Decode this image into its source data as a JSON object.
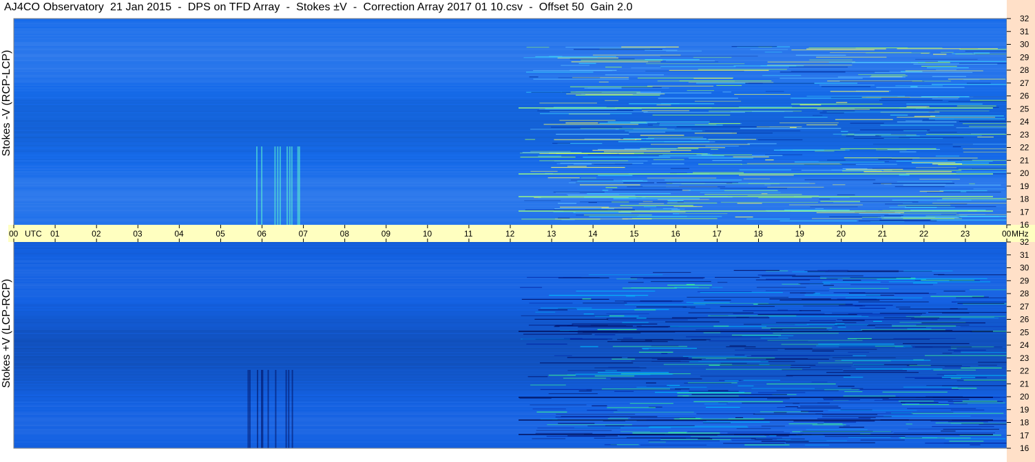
{
  "title": "AJ4CO Observatory  21 Jan 2015  -  DPS on TFD Array  -  Stokes ±V  -  Correction Array 2017 01 10.csv  -  Offset 50  Gain 2.0",
  "panels": {
    "top_label": "Stokes -V (RCP-LCP)",
    "bottom_label": "Stokes +V (LCP-RCP)"
  },
  "colors": {
    "background": "#1060e0",
    "axis_band": "#ffffc0",
    "freq_band": "#ffe0c8"
  },
  "chart_data": {
    "type": "heatmap",
    "title": "AJ4CO Observatory  21 Jan 2015  -  DPS on TFD Array  -  Stokes ±V  -  Correction Array 2017 01 10.csv  -  Offset 50  Gain 2.0",
    "x_tick_labels": [
      "00",
      "01",
      "02",
      "03",
      "04",
      "05",
      "06",
      "07",
      "08",
      "09",
      "10",
      "11",
      "12",
      "13",
      "14",
      "15",
      "16",
      "17",
      "18",
      "19",
      "20",
      "21",
      "22",
      "23",
      "00"
    ],
    "x_unit": "UTC",
    "y_tick_labels": [
      "32",
      "31",
      "30",
      "29",
      "28",
      "27",
      "26",
      "25",
      "24",
      "23",
      "22",
      "21",
      "20",
      "19",
      "18",
      "17",
      "16"
    ],
    "y_unit": "MHz",
    "xlim": [
      0,
      24
    ],
    "ylim": [
      16,
      32
    ],
    "panels": [
      {
        "name": "Stokes -V (RCP-LCP)"
      },
      {
        "name": "Stokes +V (LCP-RCP)"
      }
    ],
    "colormap": "jet"
  }
}
